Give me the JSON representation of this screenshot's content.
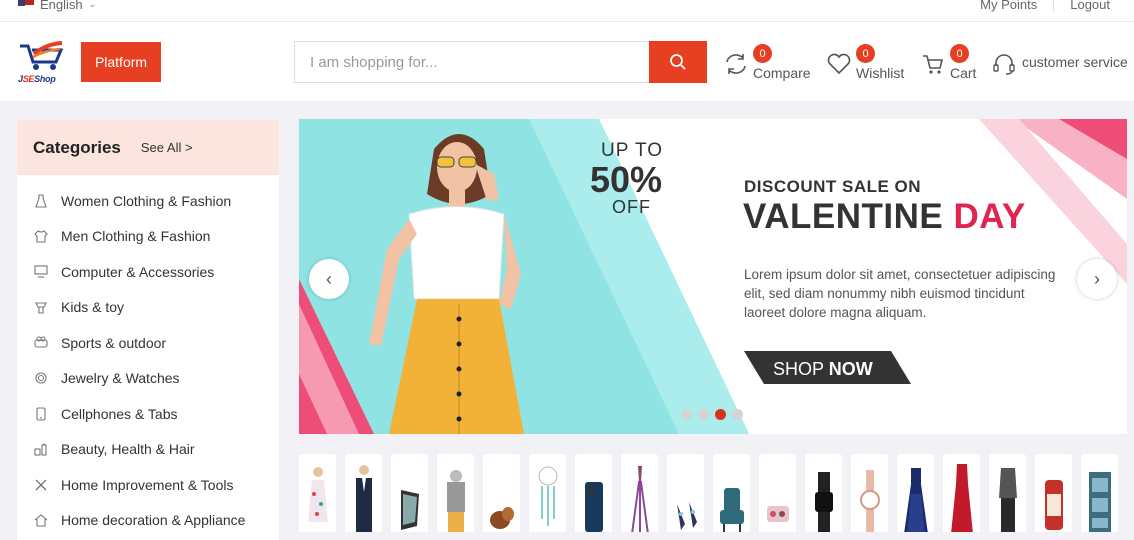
{
  "topbar": {
    "language": "English",
    "links": [
      "My Points",
      "Logout"
    ]
  },
  "header": {
    "logo_text_a": "J",
    "logo_text_b": "SE",
    "logo_text_c": "Shop",
    "platform_label": "Platform",
    "search_placeholder": "I am shopping for...",
    "compare": {
      "label": "Compare",
      "count": "0"
    },
    "wishlist": {
      "label": "Wishlist",
      "count": "0"
    },
    "cart": {
      "label": "Cart",
      "count": "0"
    },
    "service_label": "customer service"
  },
  "sidebar": {
    "title": "Categories",
    "see_all": "See All >",
    "items": [
      {
        "label": "Women Clothing & Fashion",
        "icon": "dress-icon"
      },
      {
        "label": "Men Clothing & Fashion",
        "icon": "shirt-icon"
      },
      {
        "label": "Computer & Accessories",
        "icon": "monitor-icon"
      },
      {
        "label": "Kids & toy",
        "icon": "toy-icon"
      },
      {
        "label": "Sports & outdoor",
        "icon": "sports-icon"
      },
      {
        "label": "Jewelry & Watches",
        "icon": "watch-icon"
      },
      {
        "label": "Cellphones & Tabs",
        "icon": "phone-icon"
      },
      {
        "label": "Beauty, Health & Hair",
        "icon": "beauty-icon"
      },
      {
        "label": "Home Improvement & Tools",
        "icon": "tools-icon"
      },
      {
        "label": "Home decoration & Appliance",
        "icon": "home-icon"
      }
    ]
  },
  "banner": {
    "up_to": "UP TO",
    "percent": "50%",
    "off": "OFF",
    "discount_line": "DISCOUNT SALE ON",
    "headline_a": "VALENTINE",
    "headline_b": "DAY",
    "body_1": "Lorem ipsum dolor sit amet, consectetuer adipiscing",
    "body_2": "elit, sed diam nonummy nibh euismod tincidunt",
    "body_3": "laoreet dolore magna aliquam.",
    "cta_a": "SHOP",
    "cta_b": "NOW",
    "active_slide": 3,
    "slide_count": 4
  },
  "colors": {
    "accent": "#e63f22",
    "category_header_bg": "#fce4df",
    "banner_teal": "#8fe3e3",
    "banner_pink": "#ee4d78"
  },
  "products": [
    "floral-dress",
    "suit-man",
    "laptop",
    "kid-jacket",
    "boxing-glove",
    "jewelry-dreamcatcher",
    "smartphone",
    "makeup-brush",
    "earrings",
    "armchair",
    "makeup-kit",
    "smartwatch",
    "wrist-watch",
    "blue-dress",
    "red-dress",
    "vest",
    "cosmetics-red",
    "cabinet"
  ]
}
